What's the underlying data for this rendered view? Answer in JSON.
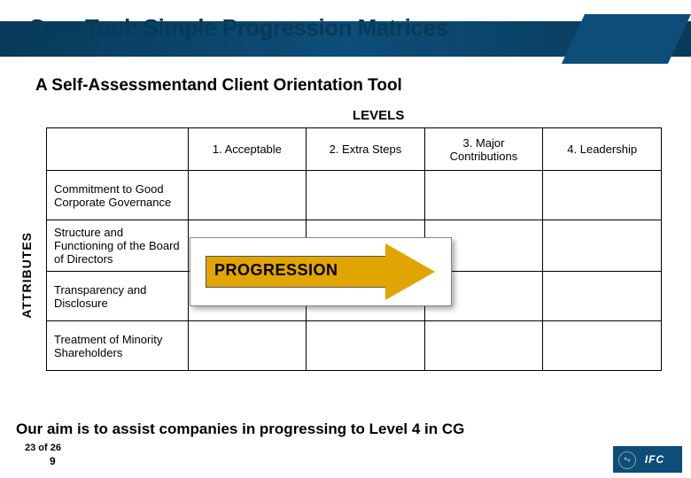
{
  "title": "Core Tool: Simple Progression Matrices",
  "subtitle": "A Self-Assessmentand Client Orientation Tool",
  "axis_labels": {
    "levels": "LEVELS",
    "attributes": "ATTRIBUTES"
  },
  "levels": [
    "1. Acceptable",
    "2. Extra Steps",
    "3. Major Contributions",
    "4. Leadership"
  ],
  "attributes": [
    "Commitment to Good Corporate Governance",
    "Structure and Functioning of the Board of Directors",
    "Transparency and Disclosure",
    "Treatment of Minority Shareholders"
  ],
  "arrow_label": "PROGRESSION",
  "footer": "Our aim is to assist companies in progressing to Level 4 in CG",
  "page": {
    "text": "23 of 26",
    "num": "9"
  },
  "logo": "IFC",
  "colors": {
    "brand": "#0d4d78",
    "arrow": "#e0a500"
  }
}
